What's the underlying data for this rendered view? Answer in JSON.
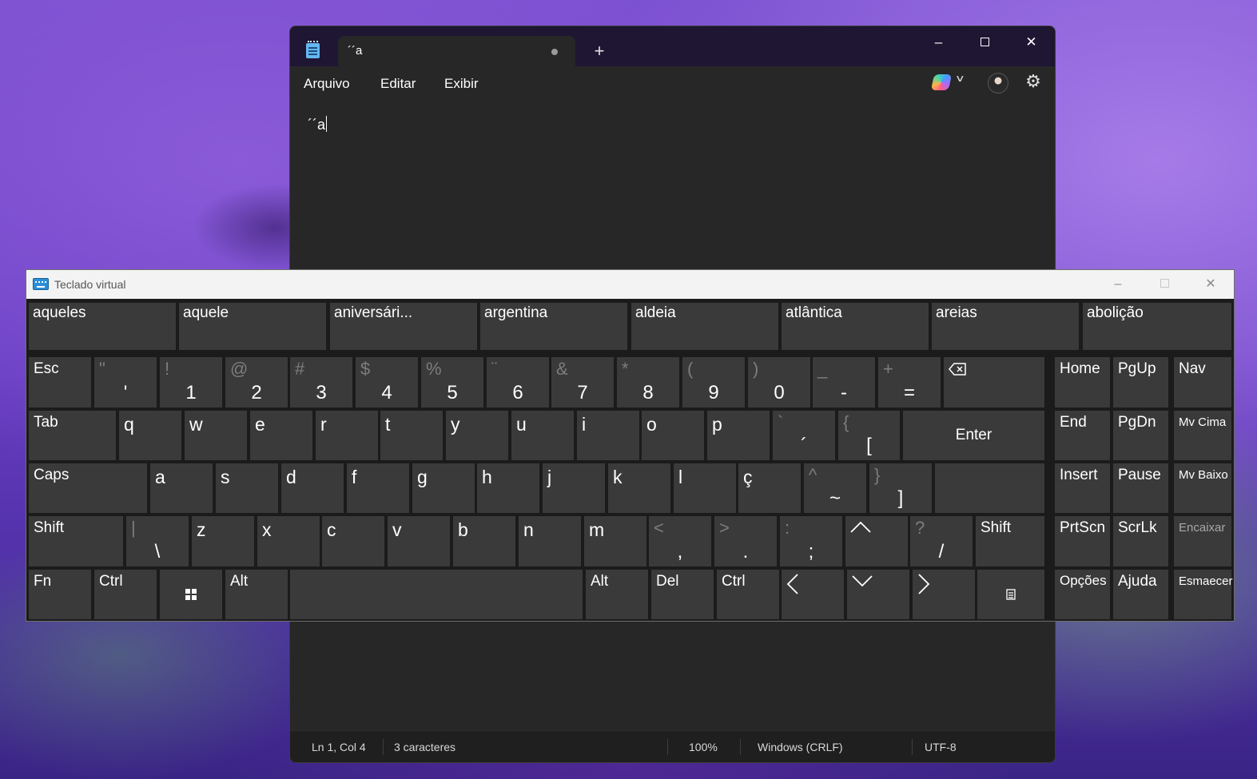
{
  "notepad": {
    "tab_title": "´´a",
    "new_tab": "+",
    "menu": [
      "Arquivo",
      "Editar",
      "Exibir"
    ],
    "content": "´´a",
    "status": {
      "position": "Ln 1, Col 4",
      "chars": "3 caracteres",
      "zoom": "100%",
      "line_ending": "Windows (CRLF)",
      "encoding": "UTF-8"
    },
    "icons": {
      "minimize": "minimize-icon",
      "maximize": "maximize-icon",
      "close": "close-icon",
      "copilot": "copilot-icon",
      "settings": "gear-icon"
    }
  },
  "osk": {
    "title": "Teclado virtual",
    "suggestions": [
      "aqueles",
      "aquele",
      "aniversári...",
      "argentina",
      "aldeia",
      "atlântica",
      "areias",
      "abolição"
    ],
    "row1": [
      {
        "label": "Esc"
      },
      {
        "alt": "\"",
        "main": "'"
      },
      {
        "alt": "!",
        "main": "1"
      },
      {
        "alt": "@",
        "main": "2"
      },
      {
        "alt": "#",
        "main": "3"
      },
      {
        "alt": "$",
        "main": "4"
      },
      {
        "alt": "%",
        "main": "5"
      },
      {
        "alt": "¨",
        "main": "6"
      },
      {
        "alt": "&",
        "main": "7"
      },
      {
        "alt": "*",
        "main": "8"
      },
      {
        "alt": "(",
        "main": "9"
      },
      {
        "alt": ")",
        "main": "0"
      },
      {
        "alt": "_",
        "main": "-"
      },
      {
        "alt": "+",
        "main": "="
      }
    ],
    "row2": [
      {
        "label": "Tab"
      },
      {
        "label": "q"
      },
      {
        "label": "w"
      },
      {
        "label": "e"
      },
      {
        "label": "r"
      },
      {
        "label": "t"
      },
      {
        "label": "y"
      },
      {
        "label": "u"
      },
      {
        "label": "i"
      },
      {
        "label": "o"
      },
      {
        "label": "p"
      },
      {
        "alt": "`",
        "main": "´"
      },
      {
        "alt": "{",
        "main": "["
      }
    ],
    "enter": "Enter",
    "row3": [
      {
        "label": "Caps"
      },
      {
        "label": "a"
      },
      {
        "label": "s"
      },
      {
        "label": "d"
      },
      {
        "label": "f"
      },
      {
        "label": "g"
      },
      {
        "label": "h"
      },
      {
        "label": "j"
      },
      {
        "label": "k"
      },
      {
        "label": "l"
      },
      {
        "label": "ç"
      },
      {
        "alt": "^",
        "main": "~"
      },
      {
        "alt": "}",
        "main": "]"
      }
    ],
    "row4": [
      {
        "label": "Shift"
      },
      {
        "alt": "|",
        "main": "\\"
      },
      {
        "label": "z"
      },
      {
        "label": "x"
      },
      {
        "label": "c"
      },
      {
        "label": "v"
      },
      {
        "label": "b"
      },
      {
        "label": "n"
      },
      {
        "label": "m"
      },
      {
        "alt": "<",
        "main": ","
      },
      {
        "alt": ">",
        "main": "."
      },
      {
        "alt": ":",
        "main": ";"
      },
      {
        "alt": "?",
        "main": "/"
      },
      {
        "label": "Shift"
      }
    ],
    "row5": [
      {
        "label": "Fn"
      },
      {
        "label": "Ctrl"
      },
      {
        "label": "Alt"
      },
      {
        "label": "Alt"
      },
      {
        "label": "Del"
      },
      {
        "label": "Ctrl"
      }
    ],
    "nav": [
      "Home",
      "PgUp",
      "Nav",
      "End",
      "PgDn",
      "Mv Cima",
      "Insert",
      "Pause",
      "Mv Baixo",
      "PrtScn",
      "ScrLk",
      "Encaixar",
      "Opções",
      "Ajuda",
      "Esmaecer"
    ],
    "icons": {
      "backspace": "backspace-icon",
      "windows": "windows-icon",
      "menu": "context-menu-icon",
      "arrows": [
        "arrow-up-icon",
        "arrow-left-icon",
        "arrow-down-icon",
        "arrow-right-icon"
      ]
    }
  }
}
